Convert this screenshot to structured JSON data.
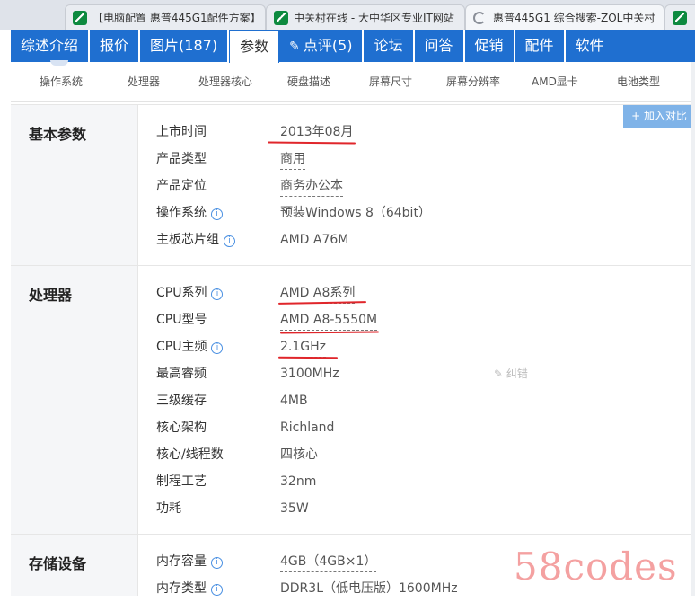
{
  "browser_tabs": [
    {
      "title": "【电脑配置 惠普445G1配件方案】"
    },
    {
      "title": "中关村在线 - 大中华区专业IT网站"
    },
    {
      "title": "惠普445G1 综合搜索-ZOL中关村"
    },
    {
      "title": ""
    }
  ],
  "nav_tabs": [
    {
      "label": "综述介绍"
    },
    {
      "label": "报价"
    },
    {
      "label": "图片(187)"
    },
    {
      "label": "参数",
      "active": true
    },
    {
      "label": "点评(5)",
      "icon": "pencil-icon"
    },
    {
      "label": "论坛"
    },
    {
      "label": "问答"
    },
    {
      "label": "促销"
    },
    {
      "label": "配件"
    },
    {
      "label": "软件"
    }
  ],
  "sub_nav": [
    "操作系统",
    "处理器",
    "处理器核心",
    "硬盘描述",
    "屏幕尺寸",
    "屏幕分辨率",
    "AMD显卡",
    "电池类型"
  ],
  "compare_button": "+ 加入对比",
  "sections": [
    {
      "title": "基本参数",
      "rows": [
        {
          "label": "上市时间",
          "value": "2013年08月"
        },
        {
          "label": "产品类型",
          "value": "商用"
        },
        {
          "label": "产品定位",
          "value": "商务办公本"
        },
        {
          "label": "操作系统",
          "value": "预装Windows 8（64bit）"
        },
        {
          "label": "主板芯片组",
          "value": "AMD A76M"
        }
      ]
    },
    {
      "title": "处理器",
      "rows": [
        {
          "label": "CPU系列",
          "value": "AMD A8系列"
        },
        {
          "label": "CPU型号",
          "value": "AMD A8-5550M"
        },
        {
          "label": "CPU主频",
          "value": "2.1GHz"
        },
        {
          "label": "最高睿频",
          "value": "3100MHz",
          "extra": "纠错"
        },
        {
          "label": "三级缓存",
          "value": "4MB"
        },
        {
          "label": "核心架构",
          "value": "Richland"
        },
        {
          "label": "核心/线程数",
          "value": "四核心"
        },
        {
          "label": "制程工艺",
          "value": "32nm"
        },
        {
          "label": "功耗",
          "value": "35W"
        }
      ]
    },
    {
      "title": "存储设备",
      "rows": [
        {
          "label": "内存容量",
          "value": "4GB（4GB×1）"
        },
        {
          "label": "内存类型",
          "value": "DDR3L（低电压版）1600MHz"
        }
      ]
    }
  ],
  "watermark": "58codes",
  "colors": {
    "nav_blue": "#1f6fd0",
    "annotation_red": "#e0262b",
    "info_blue": "#4a90e2"
  }
}
